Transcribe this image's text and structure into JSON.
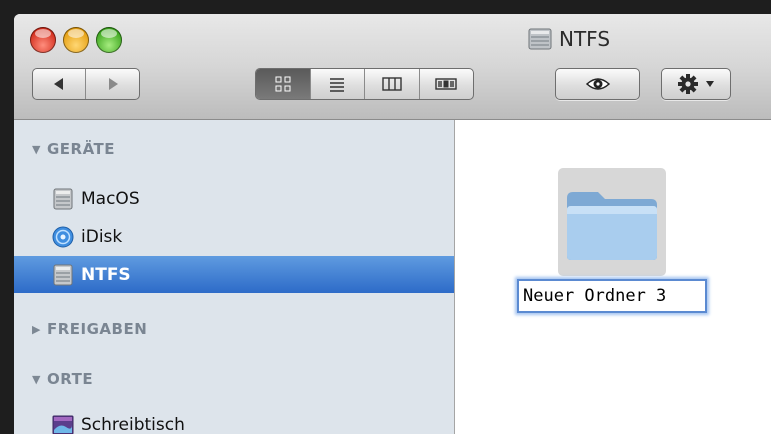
{
  "window": {
    "title": "NTFS"
  },
  "toolbar": {
    "back_icon": "triangle-left-icon",
    "forward_icon": "triangle-right-icon",
    "view_modes": [
      "icon-view-icon",
      "list-view-icon",
      "column-view-icon",
      "coverflow-view-icon"
    ],
    "active_view": "icon-view",
    "quicklook_icon": "eye-icon",
    "action_icon": "gear-icon"
  },
  "sidebar": {
    "groups": [
      {
        "label": "GERÄTE",
        "expanded": true
      },
      {
        "label": "FREIGABEN",
        "expanded": false
      },
      {
        "label": "ORTE",
        "expanded": true
      }
    ],
    "items": [
      {
        "label": "MacOS",
        "icon": "hard-drive-icon"
      },
      {
        "label": "iDisk",
        "icon": "idisk-icon"
      },
      {
        "label": "NTFS",
        "icon": "hard-drive-icon",
        "selected": true
      },
      {
        "label": "Schreibtisch",
        "icon": "desktop-icon"
      }
    ]
  },
  "content": {
    "folder_name": "Neuer Ordner 3",
    "folder_icon": "folder-icon"
  },
  "colors": {
    "selection": "#2d6bc8",
    "sidebar_bg": "#dde4eb",
    "close": "#d22d1c",
    "minimize": "#e59f11",
    "zoom": "#3da61f"
  }
}
